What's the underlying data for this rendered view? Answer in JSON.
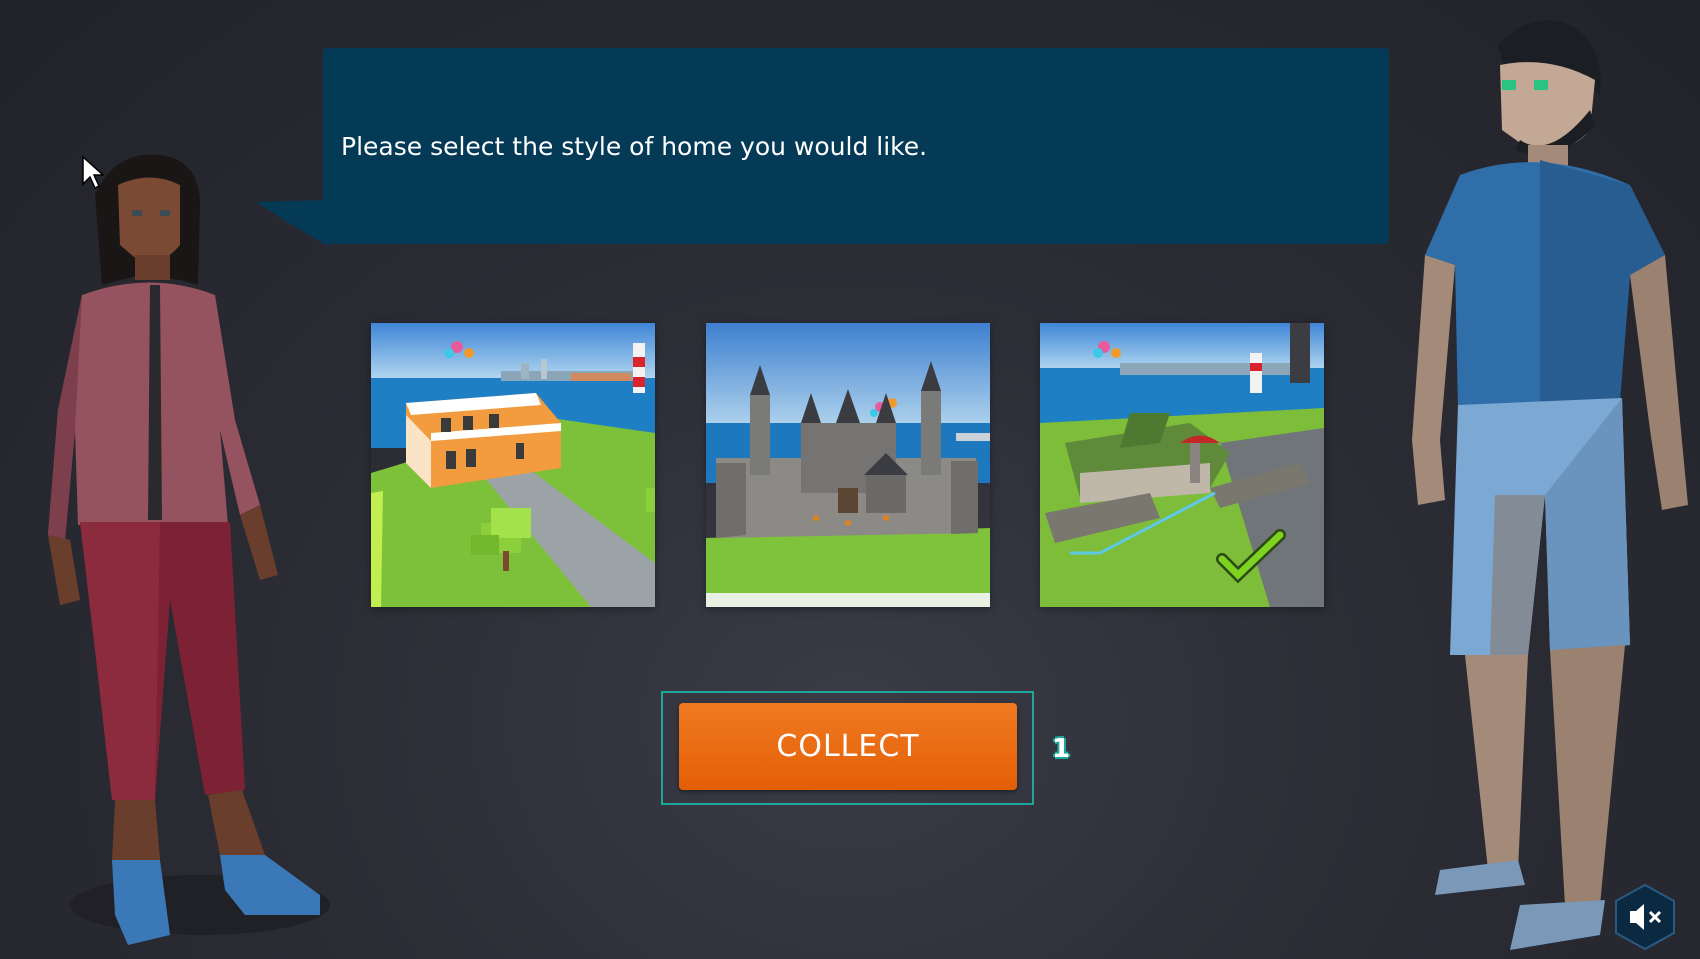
{
  "dialog": {
    "prompt": "Please select the style of home you would like."
  },
  "options": [
    {
      "label": "modern-house",
      "selected": false
    },
    {
      "label": "castle",
      "selected": false
    },
    {
      "label": "manor",
      "selected": true
    }
  ],
  "collect": {
    "label": "COLLECT",
    "badge": "1"
  },
  "colors": {
    "bubble": "#053a57",
    "button": "#e8680f",
    "focus": "#1ba89a",
    "check": "#7ed321"
  },
  "icons": [
    "cursor-icon",
    "checkmark-icon",
    "mute-icon"
  ]
}
